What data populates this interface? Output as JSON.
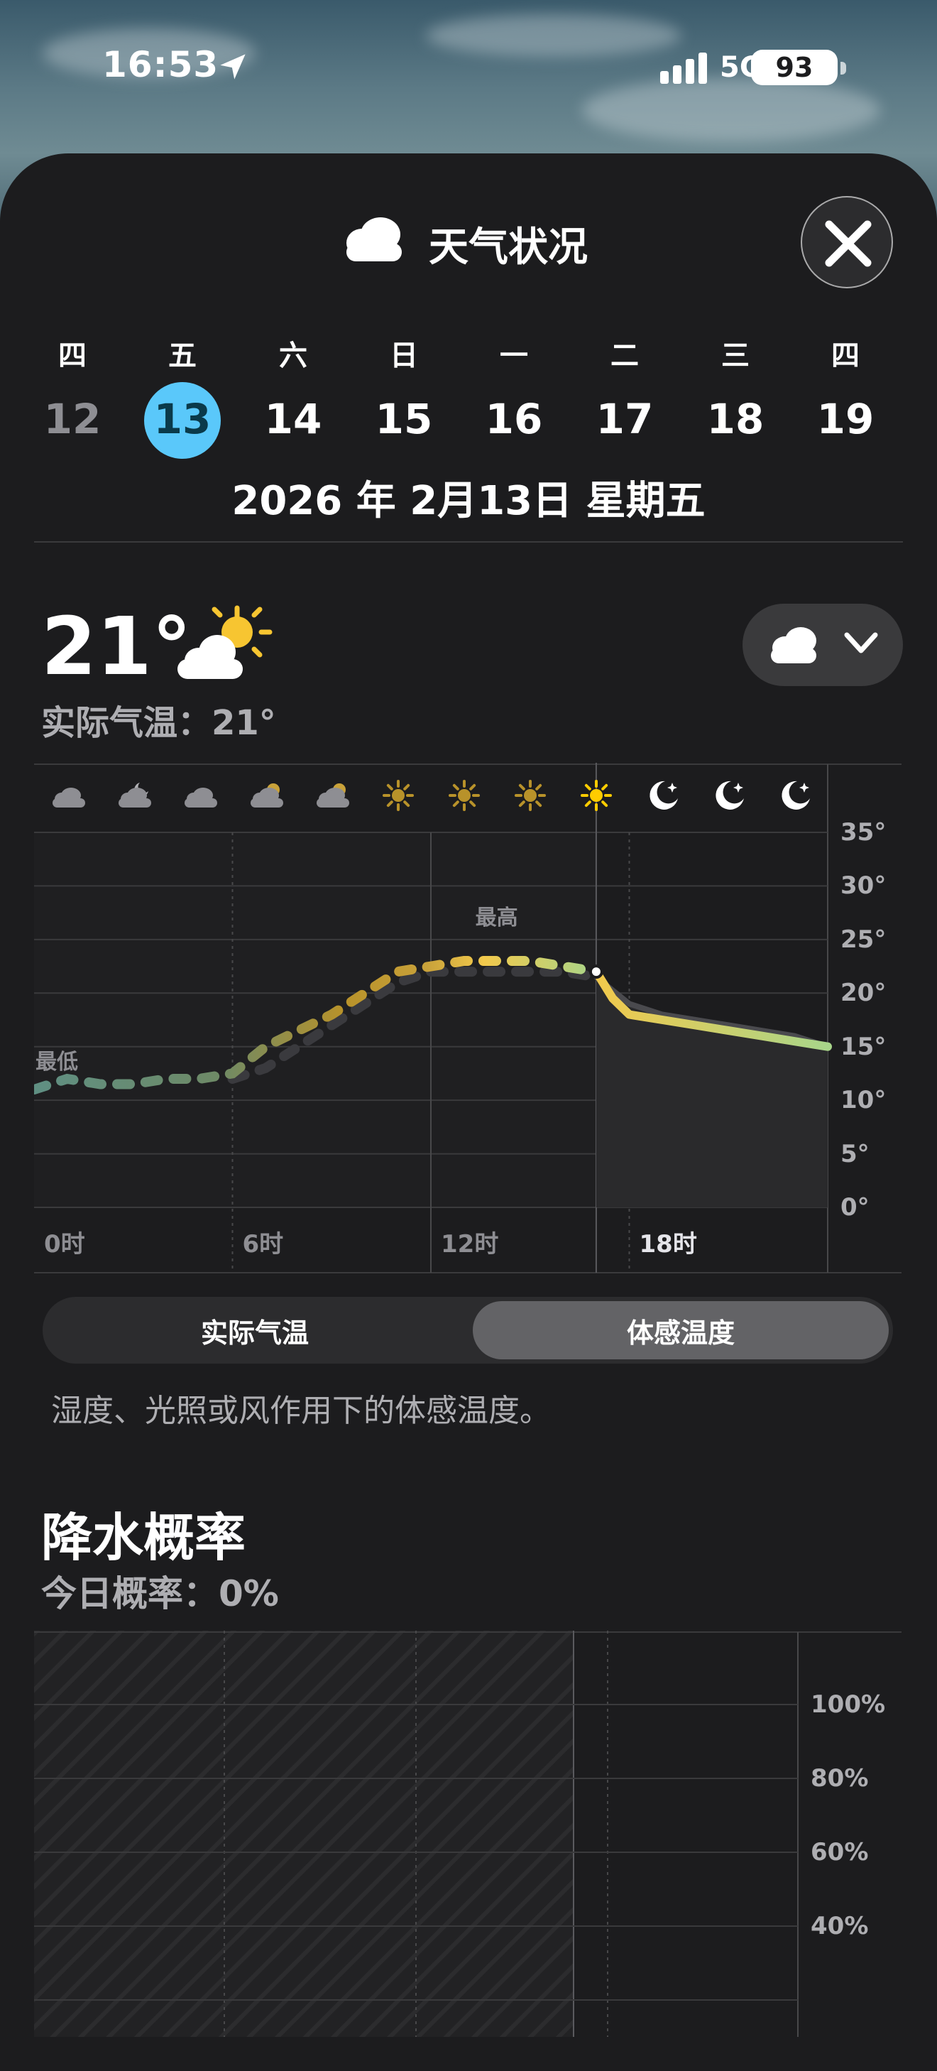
{
  "status_bar": {
    "time": "16:53",
    "network": "5GA",
    "battery": "93"
  },
  "sheet": {
    "title": "天气状况",
    "close_icon": "xmark-icon"
  },
  "week": {
    "weekdays": [
      "四",
      "五",
      "六",
      "日",
      "一",
      "二",
      "三",
      "四"
    ],
    "days": [
      "12",
      "13",
      "14",
      "15",
      "16",
      "17",
      "18",
      "19"
    ],
    "selected_day": "13",
    "full_date": "2026 年 2月13日 星期五"
  },
  "current": {
    "temperature": "21°",
    "icon": "partly-sunny-icon",
    "actual_temp_label": "实际气温：21°"
  },
  "chart_labels": {
    "high": "最高",
    "low": "最低",
    "hour_icons": [
      "cloud",
      "cloud-moon",
      "cloud",
      "cloud-sun",
      "cloud-sun",
      "sun",
      "sun",
      "sun",
      "sun",
      "moon-stars",
      "moon-stars",
      "moon-stars"
    ]
  },
  "chart_data": {
    "type": "line",
    "x_labels": [
      "0时",
      "6时",
      "12时",
      "18时"
    ],
    "y_ticks": [
      "35°",
      "30°",
      "25°",
      "20°",
      "15°",
      "10°",
      "5°",
      "0°"
    ],
    "ylim": [
      0,
      35
    ],
    "x_range": [
      0,
      24
    ],
    "current_hour": 17,
    "series": [
      {
        "name": "体感温度",
        "x": [
          0,
          1,
          2,
          3,
          4,
          5,
          6,
          7,
          8,
          9,
          10,
          11,
          12,
          13,
          14,
          15,
          16,
          17,
          17.5,
          18,
          19,
          20,
          21,
          22,
          23,
          24
        ],
        "y": [
          11,
          12,
          11.5,
          11.5,
          12,
          12,
          12.5,
          15,
          16.5,
          18,
          20,
          22,
          22.5,
          23,
          23,
          23,
          22.5,
          22,
          19.5,
          18,
          17.5,
          17,
          16.5,
          16,
          15.5,
          15
        ]
      },
      {
        "name": "实际气温",
        "x": [
          6,
          7,
          8,
          9,
          10,
          11,
          12,
          13,
          14,
          15,
          16,
          17,
          18,
          19,
          20,
          21,
          22,
          23,
          24
        ],
        "y": [
          12,
          13,
          15,
          17,
          19,
          21,
          22,
          22,
          22,
          22,
          22,
          21.5,
          19,
          18,
          17.5,
          17,
          16.5,
          16,
          15
        ]
      }
    ]
  },
  "segmented": {
    "options": [
      "实际气温",
      "体感温度"
    ],
    "selected": "体感温度"
  },
  "description": "湿度、光照或风作用下的体感温度。",
  "precipitation": {
    "title": "降水概率",
    "subtitle": "今日概率：0%",
    "y_ticks": [
      "100%",
      "80%",
      "60%",
      "40%"
    ]
  }
}
